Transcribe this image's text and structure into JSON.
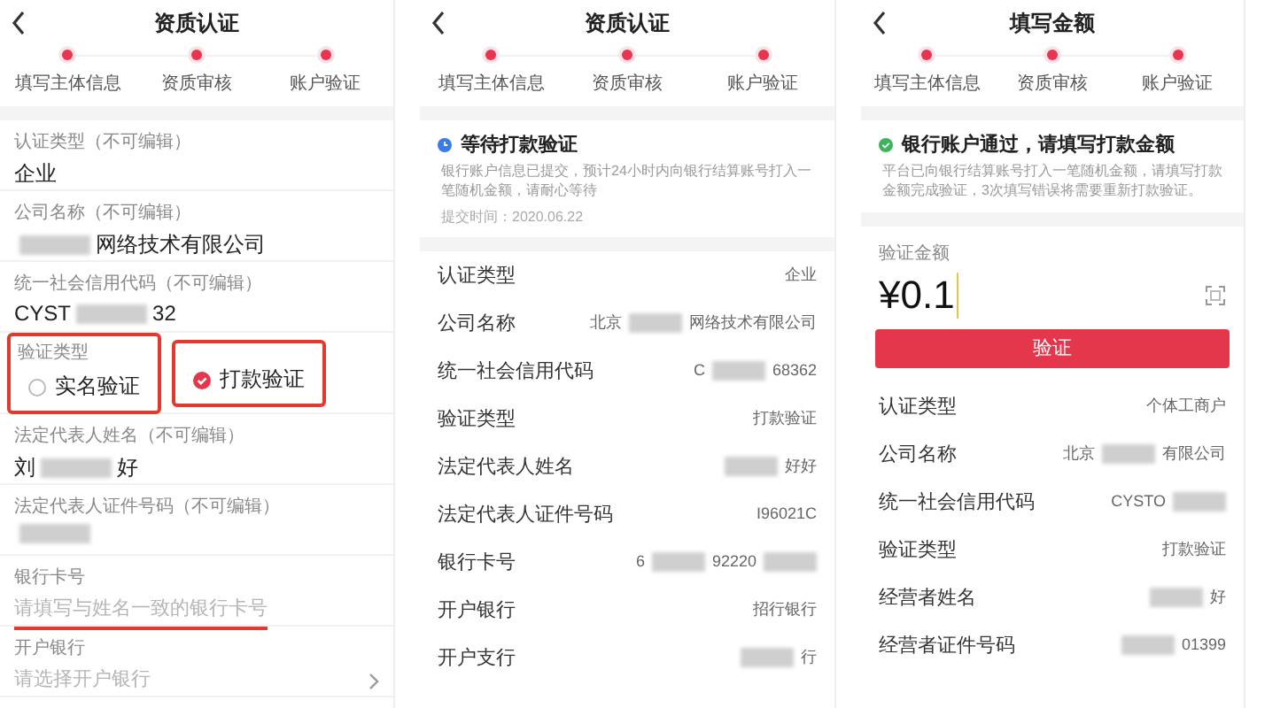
{
  "screens": [
    {
      "kind": "form",
      "title": "资质认证",
      "steps": [
        {
          "label": "填写主体信息",
          "done": true
        },
        {
          "label": "资质审核",
          "done": true
        },
        {
          "label": "账户验证",
          "done": true
        }
      ],
      "fields": [
        {
          "kind": "text",
          "label": "认证类型（不可编辑）",
          "segments": [
            {
              "kind": "text",
              "text": "企业"
            }
          ]
        },
        {
          "kind": "text",
          "label": "公司名称（不可编辑）",
          "segments": [
            {
              "kind": "blur"
            },
            {
              "kind": "text",
              "text": "网络技术有限公司"
            }
          ]
        },
        {
          "kind": "text",
          "label": "统一社会信用代码（不可编辑）",
          "segments": [
            {
              "kind": "text",
              "text": "CYST"
            },
            {
              "kind": "blur"
            },
            {
              "kind": "text",
              "text": "32"
            }
          ]
        },
        {
          "kind": "radio",
          "label": "验证类型",
          "options": [
            {
              "label": "实名验证",
              "selected": false,
              "highlighted": true
            },
            {
              "label": "打款验证",
              "selected": true,
              "highlighted": true
            }
          ]
        },
        {
          "kind": "text",
          "label": "法定代表人姓名（不可编辑）",
          "segments": [
            {
              "kind": "text",
              "text": "刘"
            },
            {
              "kind": "blur"
            },
            {
              "kind": "text",
              "text": "好"
            }
          ]
        },
        {
          "kind": "text",
          "label": "法定代表人证件号码（不可编辑）",
          "segments": [
            {
              "kind": "blur"
            }
          ]
        },
        {
          "kind": "input",
          "label": "银行卡号",
          "placeholder": "请填写与姓名一致的银行卡号",
          "underlined": true
        },
        {
          "kind": "select",
          "label": "开户银行",
          "placeholder": "请选择开户银行"
        }
      ]
    },
    {
      "kind": "review",
      "title": "资质认证",
      "steps": [
        {
          "label": "填写主体信息",
          "done": true
        },
        {
          "label": "资质审核",
          "done": true
        },
        {
          "label": "账户验证",
          "done": true
        }
      ],
      "status": {
        "kind": "pending",
        "title": "等待打款验证",
        "text": "银行账户信息已提交，预计24小时内向银行结算账号打入一笔随机金额，请耐心等待",
        "time": "提交时间：2020.06.22"
      },
      "rows": [
        {
          "label": "认证类型",
          "segments": [
            {
              "kind": "text",
              "text": "企业"
            }
          ]
        },
        {
          "label": "公司名称",
          "segments": [
            {
              "kind": "text",
              "text": "北京"
            },
            {
              "kind": "blur"
            },
            {
              "kind": "text",
              "text": "网络技术有限公司"
            }
          ]
        },
        {
          "label": "统一社会信用代码",
          "segments": [
            {
              "kind": "text",
              "text": "C"
            },
            {
              "kind": "blur"
            },
            {
              "kind": "text",
              "text": "68362"
            }
          ]
        },
        {
          "label": "验证类型",
          "segments": [
            {
              "kind": "text",
              "text": "打款验证"
            }
          ]
        },
        {
          "label": "法定代表人姓名",
          "segments": [
            {
              "kind": "blur"
            },
            {
              "kind": "text",
              "text": "好好"
            }
          ]
        },
        {
          "label": "法定代表人证件号码",
          "segments": [
            {
              "kind": "text",
              "text": "I96021C"
            }
          ]
        },
        {
          "label": "银行卡号",
          "segments": [
            {
              "kind": "text",
              "text": "6"
            },
            {
              "kind": "blur"
            },
            {
              "kind": "text",
              "text": "92220"
            },
            {
              "kind": "blur"
            }
          ]
        },
        {
          "label": "开户银行",
          "segments": [
            {
              "kind": "text",
              "text": "招行银行"
            }
          ]
        },
        {
          "label": "开户支行",
          "segments": [
            {
              "kind": "blur"
            },
            {
              "kind": "text",
              "text": "行"
            }
          ]
        }
      ]
    },
    {
      "kind": "amount",
      "title": "填写金额",
      "steps": [
        {
          "label": "填写主体信息",
          "done": true
        },
        {
          "label": "资质审核",
          "done": true
        },
        {
          "label": "账户验证",
          "done": true
        }
      ],
      "status": {
        "kind": "success",
        "title": "银行账户通过，请填写打款金额",
        "text": "平台已向银行结算账号打入一笔随机金额，请填写打款金额完成验证，3次填写错误将需要重新打款验证。"
      },
      "amount_field": {
        "label": "验证金额",
        "value": "¥0.1"
      },
      "button": "验证",
      "rows": [
        {
          "label": "认证类型",
          "segments": [
            {
              "kind": "text",
              "text": "个体工商户"
            }
          ]
        },
        {
          "label": "公司名称",
          "segments": [
            {
              "kind": "text",
              "text": "北京"
            },
            {
              "kind": "blur"
            },
            {
              "kind": "text",
              "text": "有限公司"
            }
          ]
        },
        {
          "label": "统一社会信用代码",
          "segments": [
            {
              "kind": "text",
              "text": "CYSTO"
            },
            {
              "kind": "blur"
            }
          ]
        },
        {
          "label": "验证类型",
          "segments": [
            {
              "kind": "text",
              "text": "打款验证"
            }
          ]
        },
        {
          "label": "经营者姓名",
          "segments": [
            {
              "kind": "blur"
            },
            {
              "kind": "text",
              "text": "好"
            }
          ]
        },
        {
          "label": "经营者证件号码",
          "segments": [
            {
              "kind": "blur"
            },
            {
              "kind": "text",
              "text": "01399"
            }
          ]
        }
      ]
    }
  ]
}
